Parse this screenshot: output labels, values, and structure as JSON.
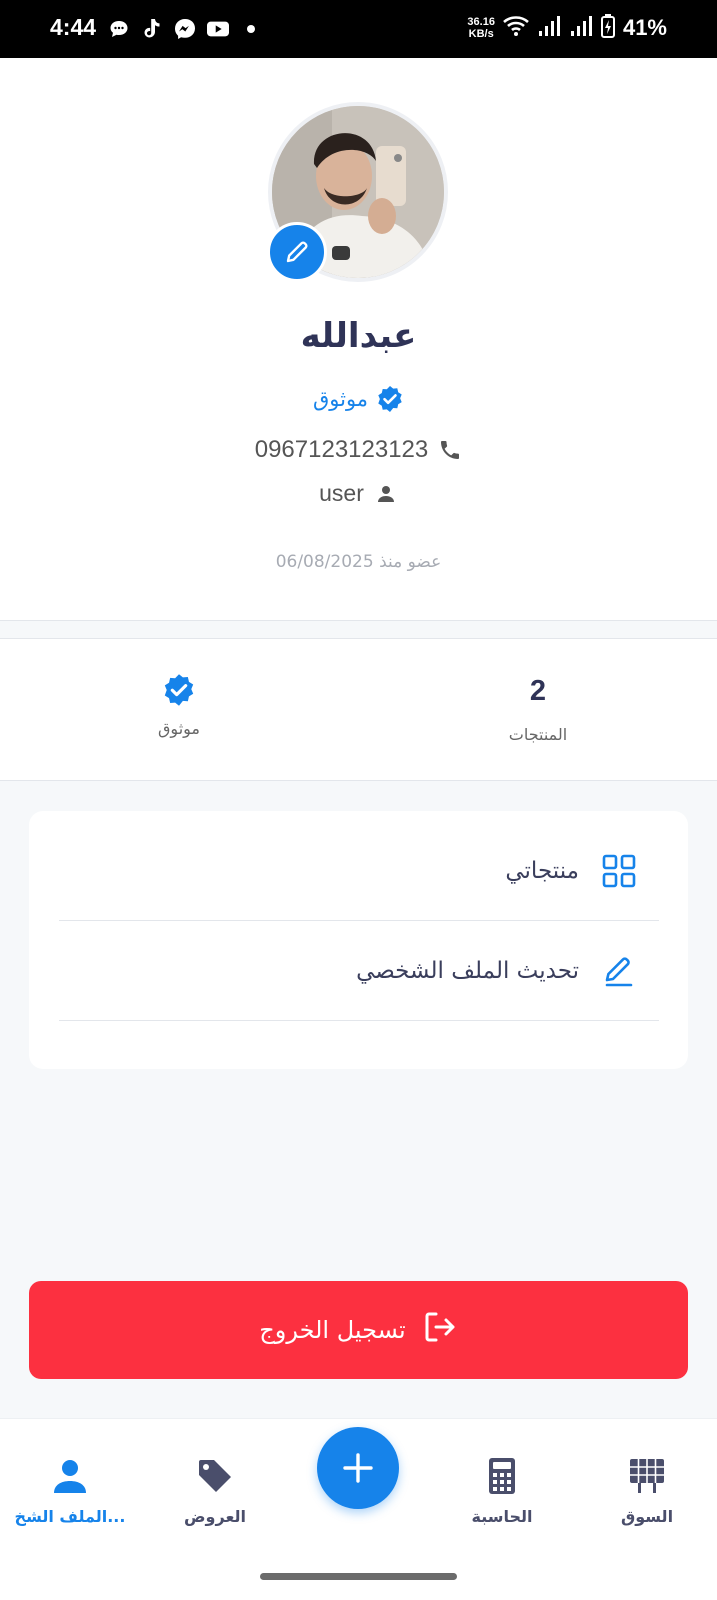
{
  "status_bar": {
    "time": "4:44",
    "net_speed_value": "36.16",
    "net_speed_unit": "KB/s",
    "battery": "41%"
  },
  "profile": {
    "name": "عبدالله",
    "verified_label": "موثوق",
    "phone": "0967123123123",
    "role": "user",
    "member_since_label": "عضو منذ",
    "member_since_date": "06/08/2025"
  },
  "stats": {
    "products_value": "2",
    "products_label": "المنتجات",
    "verified_label": "موثوق"
  },
  "menu": {
    "items": [
      {
        "label": "منتجاتي",
        "icon": "grid-icon"
      },
      {
        "label": "تحديث الملف الشخصي",
        "icon": "pencil-icon"
      }
    ]
  },
  "logout": {
    "label": "تسجيل الخروج",
    "color": "#fc3040"
  },
  "bottom_nav": {
    "items": [
      {
        "label": "السوق",
        "icon": "market-grid-icon"
      },
      {
        "label": "الحاسبة",
        "icon": "calculator-icon"
      },
      {
        "label": "العروض",
        "icon": "tag-icon"
      },
      {
        "label": "الملف الشخ...",
        "icon": "person-icon",
        "active": true
      }
    ],
    "fab_icon": "plus-icon"
  },
  "colors": {
    "accent": "#1683ea",
    "text_dark": "#2f3357",
    "background": "#f6f8fa"
  }
}
